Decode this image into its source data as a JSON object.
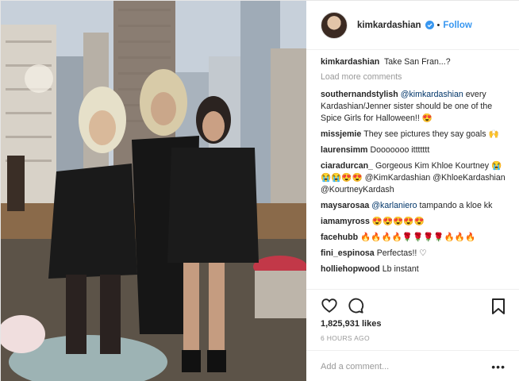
{
  "header": {
    "username": "kimkardashian",
    "separator": "•",
    "follow_label": "Follow"
  },
  "caption": {
    "author": "kimkardashian",
    "text": "Take San Fran...?"
  },
  "load_more_label": "Load more comments",
  "comments": [
    {
      "author": "southernandstylish",
      "mention": "@kimkardashian",
      "text": "every Kardashian/Jenner sister should be one of the Spice Girls for Halloween!! 😍"
    },
    {
      "author": "missjemie",
      "mention": "",
      "text": "They see pictures they say goals 🙌"
    },
    {
      "author": "laurensimm",
      "mention": "",
      "text": "Dooooooo ittttttt"
    },
    {
      "author": "ciaradurcan_",
      "mention": "",
      "text": "Gorgeous Kim Khloe Kourtney 😭😭😭😍😍 @KimKardashian @KhloeKardashian @KourtneyKardash"
    },
    {
      "author": "maysarosaa",
      "mention": "@karlaniero",
      "text": "tampando a kloe kk"
    },
    {
      "author": "iamamyross",
      "mention": "",
      "text": "😍😍😍😍😍"
    },
    {
      "author": "facehubb",
      "mention": "",
      "text": "🔥🔥🔥🔥🌹🌹🌹🌹🔥🔥🔥"
    },
    {
      "author": "fini_espinosa",
      "mention": "",
      "text": "Perfectas!! ♡"
    },
    {
      "author": "holliehopwood",
      "mention": "",
      "text": "Lb instant"
    }
  ],
  "likes_text": "1,825,931 likes",
  "timestamp": "6 HOURS AGO",
  "add_comment_placeholder": "Add a comment...",
  "more_label": "•••",
  "icons": {
    "verified": "verified-badge-icon",
    "like": "heart-icon",
    "comment": "comment-bubble-icon",
    "save": "bookmark-icon",
    "more": "more-options-icon"
  },
  "colors": {
    "accent": "#3897f0",
    "mention": "#003569",
    "muted": "#999999",
    "text": "#262626"
  }
}
